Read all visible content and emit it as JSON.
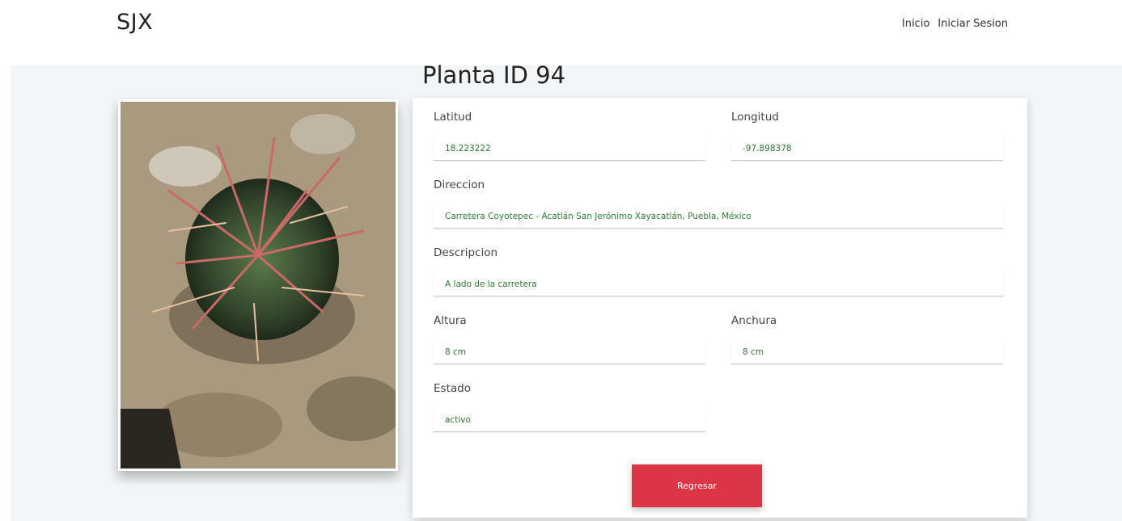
{
  "header": {
    "brand": "SJX",
    "nav": [
      "Inicio",
      "Iniciar Sesion"
    ]
  },
  "page": {
    "title": "Planta ID 94"
  },
  "form": {
    "latitud": {
      "label": "Latitud",
      "value": "18.223222"
    },
    "longitud": {
      "label": "Longitud",
      "value": "-97.898378"
    },
    "direccion": {
      "label": "Direccion",
      "value": "Carretera Coyotepec - Acatlán San Jerónimo Xayacatlán, Puebla, México"
    },
    "descripcion": {
      "label": "Descripcion",
      "value": "A lado de la carretera"
    },
    "altura": {
      "label": "Altura",
      "value": "8 cm"
    },
    "anchura": {
      "label": "Anchura",
      "value": "8 cm"
    },
    "estado": {
      "label": "Estado",
      "value": "activo"
    },
    "regresar_label": "Regresar"
  },
  "colors": {
    "accent_red": "#dc3545",
    "value_green": "#2e7d32",
    "content_bg": "#f3f6f8"
  }
}
